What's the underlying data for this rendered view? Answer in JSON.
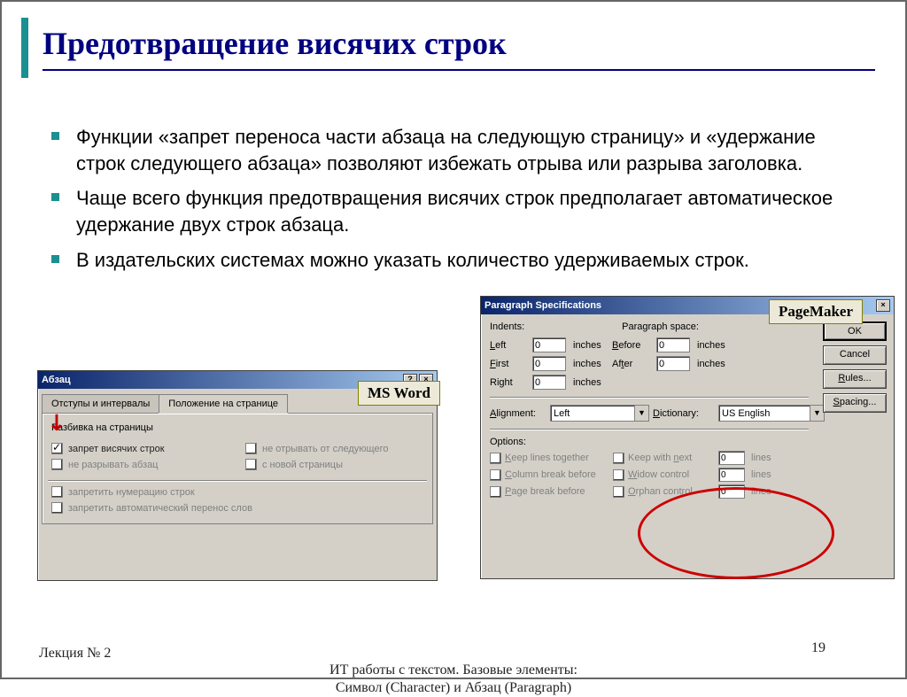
{
  "slide": {
    "title": "Предотвращение висячих строк",
    "bullets": [
      "Функции «запрет переноса части абзаца на следующую страницу» и «удержание строк следующего абзаца» позволяют избежать отрыва или разрыва заголовка.",
      "Чаще всего функция предотвращения висячих строк предполагает автоматическое удержание двух строк абзаца.",
      "В издательских системах можно указать количество удерживаемых строк."
    ],
    "footer_left": "Лекция № 2",
    "footer_center_line1": "ИТ работы с текстом. Базовые элементы:",
    "footer_center_line2": "Символ (Character) и Абзац (Paragraph)",
    "footer_right": "19"
  },
  "labels": {
    "msword": "MS Word",
    "pagemaker": "PageMaker"
  },
  "word_dialog": {
    "title": "Абзац",
    "help": "?",
    "close": "×",
    "tabs": {
      "inactive": "Отступы и интервалы",
      "active": "Положение на странице"
    },
    "group": "Разбивка на страницы",
    "widow_control": "запрет висячих строк",
    "keep_with_next": "не отрывать от следующего",
    "keep_together": "не разрывать абзац",
    "page_break_before": "с новой страницы",
    "suppress_line_numbers": "запретить нумерацию строк",
    "no_hyphenation": "запретить автоматический перенос слов"
  },
  "pm_dialog": {
    "title": "Paragraph Specifications",
    "close": "×",
    "indents_label": "Indents:",
    "paragraph_space_label": "Paragraph space:",
    "left": "Left",
    "first": "First",
    "right": "Right",
    "before": "Before",
    "after": "After",
    "inches": "inches",
    "values": {
      "left": "0",
      "first": "0",
      "right": "0",
      "before": "0",
      "after": "0"
    },
    "alignment_label": "Alignment:",
    "alignment_value": "Left",
    "dictionary_label": "Dictionary:",
    "dictionary_value": "US English",
    "options_label": "Options:",
    "keep_lines_together": "Keep lines together",
    "column_break_before": "Column break before",
    "page_break_before": "Page break before",
    "keep_with_next": "Keep with next",
    "widow_control": "Widow control",
    "orphan_control": "Orphan control",
    "lines": "lines",
    "opt_values": {
      "kwn": "0",
      "widow": "0",
      "orphan": "0"
    },
    "buttons": {
      "ok": "OK",
      "cancel": "Cancel",
      "rules": "Rules...",
      "spacing": "Spacing..."
    }
  }
}
